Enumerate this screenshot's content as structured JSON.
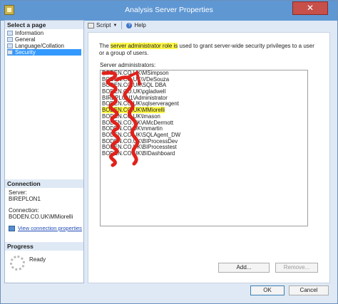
{
  "window": {
    "title": "Analysis Server Properties",
    "close_glyph": "✕"
  },
  "sidebar": {
    "select_page_title": "Select a page",
    "pages": [
      {
        "label": "Information",
        "selected": false
      },
      {
        "label": "General",
        "selected": false
      },
      {
        "label": "Language/Collation",
        "selected": false
      },
      {
        "label": "Security",
        "selected": true
      }
    ]
  },
  "connection": {
    "title": "Connection",
    "server_label": "Server:",
    "server_value": "BIREPLON1",
    "connection_label": "Connection:",
    "connection_value": "BODEN.CO.UK\\MMiorelli",
    "view_properties_link": "View connection properties"
  },
  "progress": {
    "title": "Progress",
    "status": "Ready"
  },
  "toolbar": {
    "script_label": "Script",
    "help_label": "Help",
    "caret": "▼",
    "help_glyph": "?"
  },
  "security": {
    "description_pre": "The ",
    "description_highlight": "server administrator role is",
    "description_post": " used to grant server-wide security privileges to a user or a group of users.",
    "admins_label": "Server administrators:",
    "administrators": [
      "BODEN.CO.UK\\MSimpson",
      "BODEN.CO.UK\\VDeSouza",
      "BODEN.CO.UK\\SQL DBA",
      "BODEN.CO.UK\\pgladwell",
      "BIREPLON1\\Administrator",
      "BODEN.CO.UK\\sqlserveragent",
      "BODEN.CO.UK\\MMiorelli",
      "BODEN.CO.UK\\lmason",
      "BODEN.CO.UK\\AMcDermott",
      "BODEN.CO.UK\\mmartin",
      "BODEN.CO.UK\\SQLAgent_DW",
      "BODEN.CO.UK\\BIProcessDev",
      "BODEN.CO.UK\\BIProcesstest",
      "BODEN.CO.UK\\BIDashboard"
    ],
    "highlighted_admin": "BODEN.CO.UK\\MMiorelli",
    "add_button": "Add...",
    "remove_button": "Remove..."
  },
  "footer": {
    "ok_button": "OK",
    "cancel_button": "Cancel"
  },
  "colors": {
    "highlight": "#fff84a",
    "scribble": "#e0221b",
    "titlebar": "#5f97d3",
    "selection": "#3399ff"
  }
}
